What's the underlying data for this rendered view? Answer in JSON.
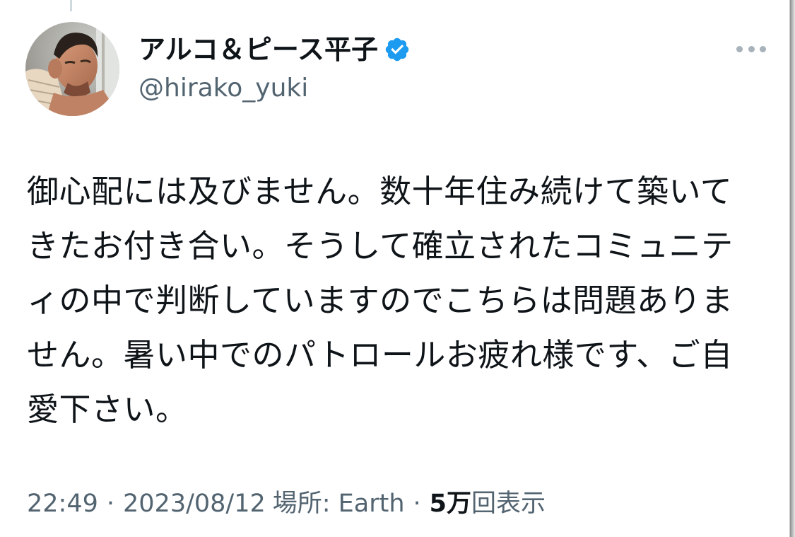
{
  "tweet": {
    "author": {
      "display_name": "アルコ＆ピース平子",
      "handle": "@hirako_yuki",
      "verified": true,
      "verified_icon": "verified-badge-icon",
      "avatar_icon": "profile-avatar"
    },
    "more_icon": "more-options-icon",
    "text": "御心配には及びません。数十年住み続けて築いてきたお付き合い。そうして確立されたコミュニティの中で判断していますのでこちらは問題ありません。暑い中でのパトロールお疲れ様です、ご自愛下さい。",
    "meta": {
      "time": "22:49",
      "separator": "·",
      "date": "2023/08/12",
      "location_label": "場所: Earth",
      "views_count": "5万",
      "views_label": "回表示"
    }
  },
  "colors": {
    "text_primary": "#0f1419",
    "text_secondary": "#536471",
    "verified_blue": "#1d9bf0",
    "background": "#ffffff"
  }
}
